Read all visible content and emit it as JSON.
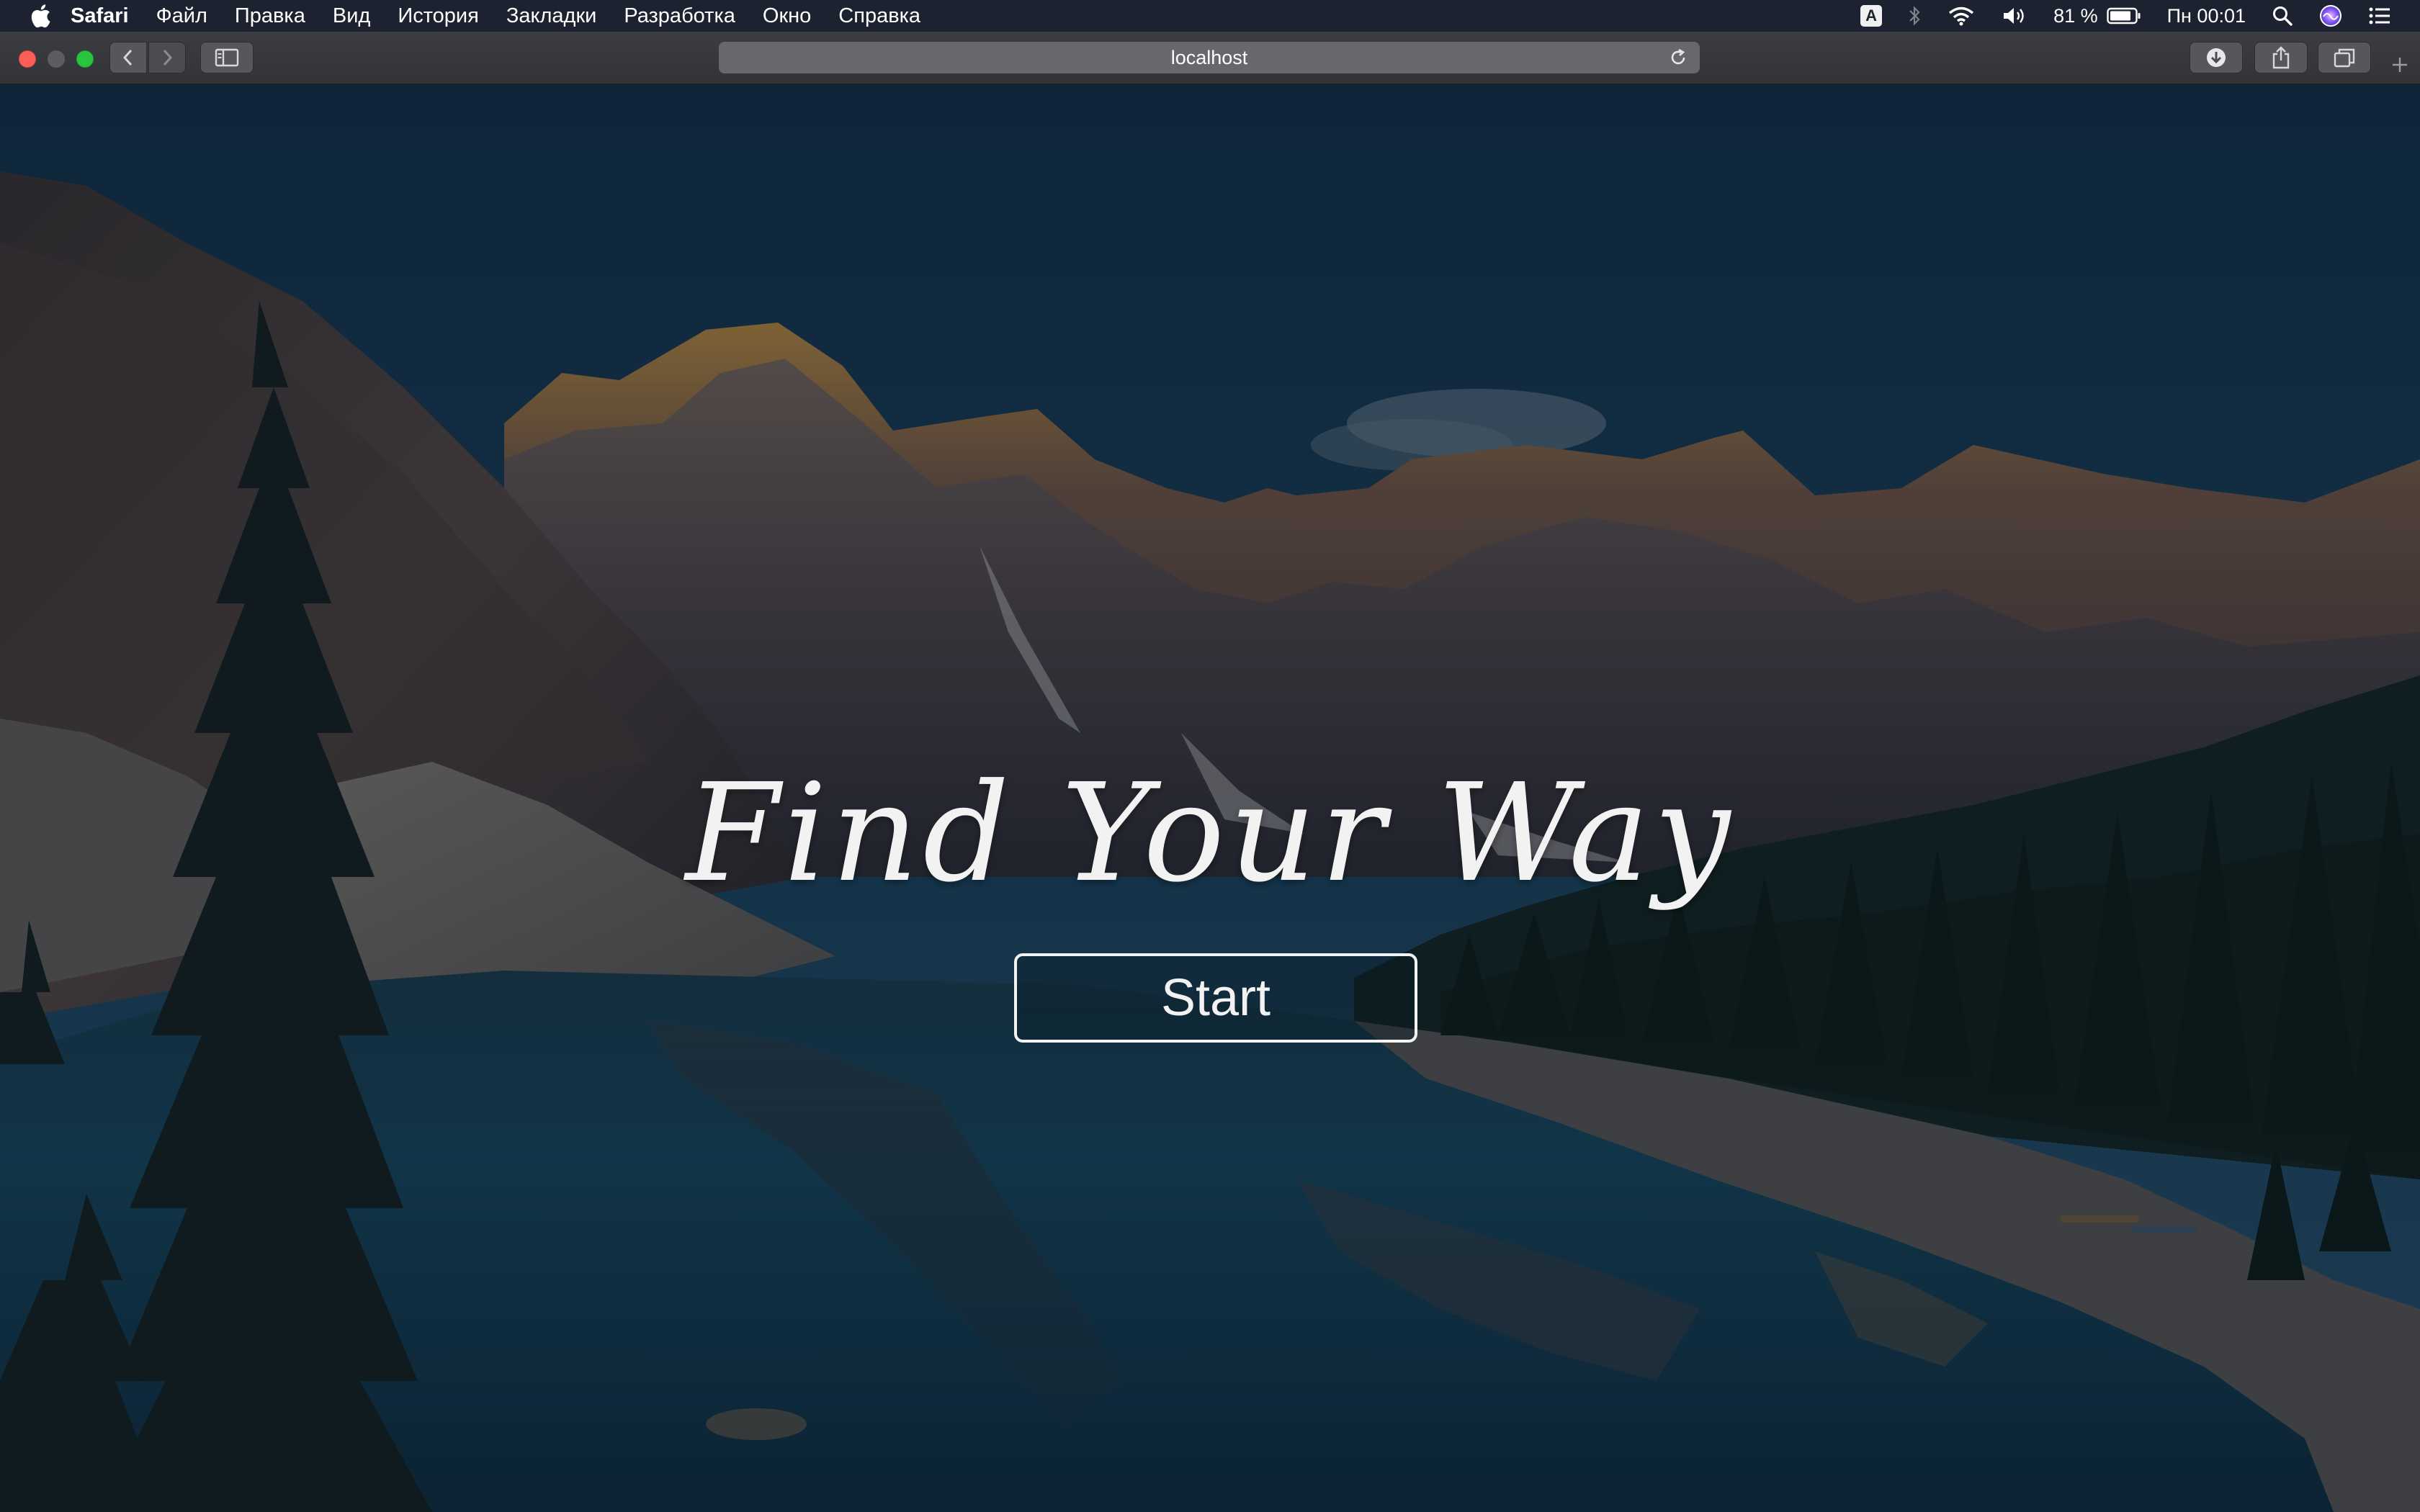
{
  "menubar": {
    "app_name": "Safari",
    "items": [
      "Файл",
      "Правка",
      "Вид",
      "История",
      "Закладки",
      "Разработка",
      "Окно",
      "Справка"
    ],
    "input_source": "A",
    "battery": "81 %",
    "clock": "Пн 00:01"
  },
  "browser": {
    "address": "localhost"
  },
  "hero": {
    "title": "Find Your Way",
    "start_label": "Start"
  }
}
